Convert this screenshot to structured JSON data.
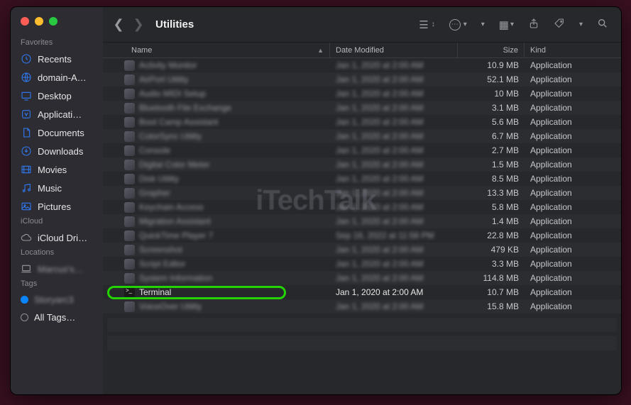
{
  "window": {
    "title": "Utilities"
  },
  "watermark": "iTechTalk",
  "sidebar": {
    "sections": [
      {
        "label": "Favorites",
        "items": [
          {
            "icon": "clock-icon",
            "label": "Recents"
          },
          {
            "icon": "globe-icon",
            "label": "domain-A…"
          },
          {
            "icon": "desktop-icon",
            "label": "Desktop"
          },
          {
            "icon": "app-icon",
            "label": "Applicati…"
          },
          {
            "icon": "doc-icon",
            "label": "Documents"
          },
          {
            "icon": "download-icon",
            "label": "Downloads"
          },
          {
            "icon": "movie-icon",
            "label": "Movies"
          },
          {
            "icon": "music-icon",
            "label": "Music"
          },
          {
            "icon": "picture-icon",
            "label": "Pictures"
          }
        ]
      },
      {
        "label": "iCloud",
        "items": [
          {
            "icon": "cloud-icon",
            "label": "iCloud Dri…"
          }
        ]
      },
      {
        "label": "Locations",
        "items": [
          {
            "icon": "laptop-icon",
            "label": "Marcus's…"
          }
        ]
      },
      {
        "label": "Tags",
        "items": [
          {
            "icon": "tag-dot",
            "label": "Storyarc3"
          },
          {
            "icon": "tag-all",
            "label": "All Tags…"
          }
        ]
      }
    ]
  },
  "columns": {
    "name": "Name",
    "date": "Date Modified",
    "size": "Size",
    "kind": "Kind"
  },
  "files": [
    {
      "name": "Activity Monitor",
      "date": "Jan 1, 2020 at 2:00 AM",
      "size": "10.9 MB",
      "kind": "Application"
    },
    {
      "name": "AirPort Utility",
      "date": "Jan 1, 2020 at 2:00 AM",
      "size": "52.1 MB",
      "kind": "Application"
    },
    {
      "name": "Audio MIDI Setup",
      "date": "Jan 1, 2020 at 2:00 AM",
      "size": "10 MB",
      "kind": "Application"
    },
    {
      "name": "Bluetooth File Exchange",
      "date": "Jan 1, 2020 at 2:00 AM",
      "size": "3.1 MB",
      "kind": "Application"
    },
    {
      "name": "Boot Camp Assistant",
      "date": "Jan 1, 2020 at 2:00 AM",
      "size": "5.6 MB",
      "kind": "Application"
    },
    {
      "name": "ColorSync Utility",
      "date": "Jan 1, 2020 at 2:00 AM",
      "size": "6.7 MB",
      "kind": "Application"
    },
    {
      "name": "Console",
      "date": "Jan 1, 2020 at 2:00 AM",
      "size": "2.7 MB",
      "kind": "Application"
    },
    {
      "name": "Digital Color Meter",
      "date": "Jan 1, 2020 at 2:00 AM",
      "size": "1.5 MB",
      "kind": "Application"
    },
    {
      "name": "Disk Utility",
      "date": "Jan 1, 2020 at 2:00 AM",
      "size": "8.5 MB",
      "kind": "Application"
    },
    {
      "name": "Grapher",
      "date": "Jan 1, 2020 at 2:00 AM",
      "size": "13.3 MB",
      "kind": "Application"
    },
    {
      "name": "Keychain Access",
      "date": "Jan 1, 2020 at 2:00 AM",
      "size": "5.8 MB",
      "kind": "Application"
    },
    {
      "name": "Migration Assistant",
      "date": "Jan 1, 2020 at 2:00 AM",
      "size": "1.4 MB",
      "kind": "Application"
    },
    {
      "name": "QuickTime Player 7",
      "date": "Sep 16, 2022 at 11:58 PM",
      "size": "22.8 MB",
      "kind": "Application"
    },
    {
      "name": "Screenshot",
      "date": "Jan 1, 2020 at 2:00 AM",
      "size": "479 KB",
      "kind": "Application"
    },
    {
      "name": "Script Editor",
      "date": "Jan 1, 2020 at 2:00 AM",
      "size": "3.3 MB",
      "kind": "Application"
    },
    {
      "name": "System Information",
      "date": "Jan 1, 2020 at 2:00 AM",
      "size": "114.8 MB",
      "kind": "Application"
    },
    {
      "name": "Terminal",
      "date": "Jan 1, 2020 at 2:00 AM",
      "size": "10.7 MB",
      "kind": "Application",
      "highlight": true
    },
    {
      "name": "VoiceOver Utility",
      "date": "Jan 1, 2020 at 2:00 AM",
      "size": "15.8 MB",
      "kind": "Application"
    }
  ]
}
